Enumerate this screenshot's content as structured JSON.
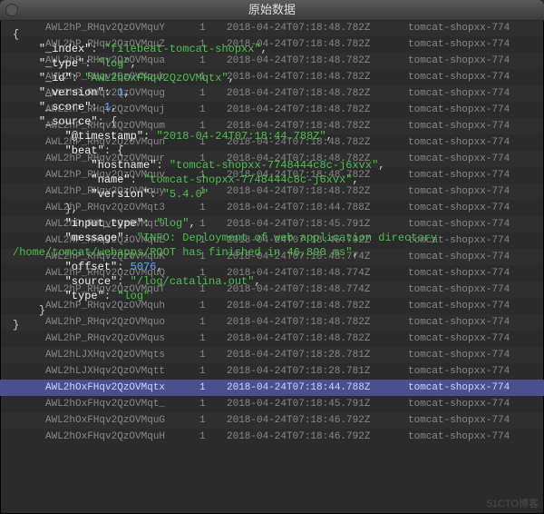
{
  "title": "原始数据",
  "watermark": "51CTO博客",
  "rows": [
    {
      "id": "AWL2hP_RHqv2QzOVMquY",
      "count": "1",
      "ts": "2018-04-24T07:18:48.782Z",
      "host": "tomcat-shopxx-774"
    },
    {
      "id": "AWL2hP_RHqv2QzOVMquZ",
      "count": "1",
      "ts": "2018-04-24T07:18:48.782Z",
      "host": "tomcat-shopxx-774"
    },
    {
      "id": "AWL2hP_RHqv2QzOVMqua",
      "count": "1",
      "ts": "2018-04-24T07:18:48.782Z",
      "host": "tomcat-shopxx-774"
    },
    {
      "id": "AWL2hP_RHqv2QzOVMqub",
      "count": "1",
      "ts": "2018-04-24T07:18:48.782Z",
      "host": "tomcat-shopxx-774"
    },
    {
      "id": "AWL2hP_RHqv2QzOVMqug",
      "count": "1",
      "ts": "2018-04-24T07:18:48.782Z",
      "host": "tomcat-shopxx-774"
    },
    {
      "id": "AWL2hP_RHqv2QzOVMquj",
      "count": "1",
      "ts": "2018-04-24T07:18:48.782Z",
      "host": "tomcat-shopxx-774"
    },
    {
      "id": "AWL2hP_RHqv2QzOVMqum",
      "count": "1",
      "ts": "2018-04-24T07:18:48.782Z",
      "host": "tomcat-shopxx-774"
    },
    {
      "id": "AWL2hP_RHqv2QzOVMqun",
      "count": "1",
      "ts": "2018-04-24T07:18:48.782Z",
      "host": "tomcat-shopxx-774"
    },
    {
      "id": "AWL2hP_RHqv2QzOVMqur",
      "count": "1",
      "ts": "2018-04-24T07:18:48.782Z",
      "host": "tomcat-shopxx-774"
    },
    {
      "id": "AWL2hP_RHqv2QzOVMquv",
      "count": "1",
      "ts": "2018-04-24T07:18:48.782Z",
      "host": "tomcat-shopxx-774"
    },
    {
      "id": "AWL2hP_RHqv2QzOVMquy",
      "count": "1",
      "ts": "2018-04-24T07:18:48.782Z",
      "host": "tomcat-shopxx-774"
    },
    {
      "id": "AWL2hP_RHqv2QzOVMqt3",
      "count": "1",
      "ts": "2018-04-24T07:18:44.788Z",
      "host": "tomcat-shopxx-774"
    },
    {
      "id": "AWL2hP_RHqv2QzOVMqt9",
      "count": "1",
      "ts": "2018-04-24T07:18:45.791Z",
      "host": "tomcat-shopxx-774"
    },
    {
      "id": "AWL2hP_RHqv2QzOVMquE",
      "count": "1",
      "ts": "2018-04-24T07:18:46.792Z",
      "host": "tomcat-shopxx-774"
    },
    {
      "id": "AWL2hP_RHqv2QzOVMquK",
      "count": "1",
      "ts": "2018-04-24T07:18:48.774Z",
      "host": "tomcat-shopxx-774"
    },
    {
      "id": "AWL2hP_RHqv2QzOVMquQ",
      "count": "1",
      "ts": "2018-04-24T07:18:48.774Z",
      "host": "tomcat-shopxx-774"
    },
    {
      "id": "AWL2hP_RHqv2QzOVMquT",
      "count": "1",
      "ts": "2018-04-24T07:18:48.774Z",
      "host": "tomcat-shopxx-774"
    },
    {
      "id": "AWL2hP_RHqv2QzOVMquh",
      "count": "1",
      "ts": "2018-04-24T07:18:48.782Z",
      "host": "tomcat-shopxx-774"
    },
    {
      "id": "AWL2hP_RHqv2QzOVMquo",
      "count": "1",
      "ts": "2018-04-24T07:18:48.782Z",
      "host": "tomcat-shopxx-774"
    },
    {
      "id": "AWL2hP_RHqv2QzOVMqus",
      "count": "1",
      "ts": "2018-04-24T07:18:48.782Z",
      "host": "tomcat-shopxx-774"
    },
    {
      "id": "AWL2hLJXHqv2QzOVMqts",
      "count": "1",
      "ts": "2018-04-24T07:18:28.781Z",
      "host": "tomcat-shopxx-774"
    },
    {
      "id": "AWL2hLJXHqv2QzOVMqtt",
      "count": "1",
      "ts": "2018-04-24T07:18:28.781Z",
      "host": "tomcat-shopxx-774"
    },
    {
      "id": "AWL2hOxFHqv2QzOVMqtx",
      "count": "1",
      "ts": "2018-04-24T07:18:44.788Z",
      "host": "tomcat-shopxx-774",
      "selected": true
    },
    {
      "id": "AWL2hOxFHqv2QzOVMqt_",
      "count": "1",
      "ts": "2018-04-24T07:18:45.791Z",
      "host": "tomcat-shopxx-774"
    },
    {
      "id": "AWL2hOxFHqv2QzOVMquG",
      "count": "1",
      "ts": "2018-04-24T07:18:46.792Z",
      "host": "tomcat-shopxx-774"
    },
    {
      "id": "AWL2hOxFHqv2QzOVMquH",
      "count": "1",
      "ts": "2018-04-24T07:18:46.792Z",
      "host": "tomcat-shopxx-774"
    }
  ],
  "json": {
    "_index": "filebeat-tomcat-shopxx",
    "_type": "log",
    "_id": "AWL2hOxFHqv2QzOVMqtx",
    "_version": 1,
    "_score": 1,
    "_source": {
      "@timestamp": "2018-04-24T07:18:44.788Z",
      "beat": {
        "hostname": "tomcat-shopxx-7748444c8c-j6xvx",
        "name": "tomcat-shopxx-7748444c8c-j6xvx",
        "version": "5.4.0"
      },
      "input_type": "log",
      "message": "INFO: Deployment of web application directory /home/tomcat/webapps/ROOT has finished in 46,890 ms",
      "offset": 5076,
      "source": "/log/catalina.out",
      "type": "log"
    }
  }
}
